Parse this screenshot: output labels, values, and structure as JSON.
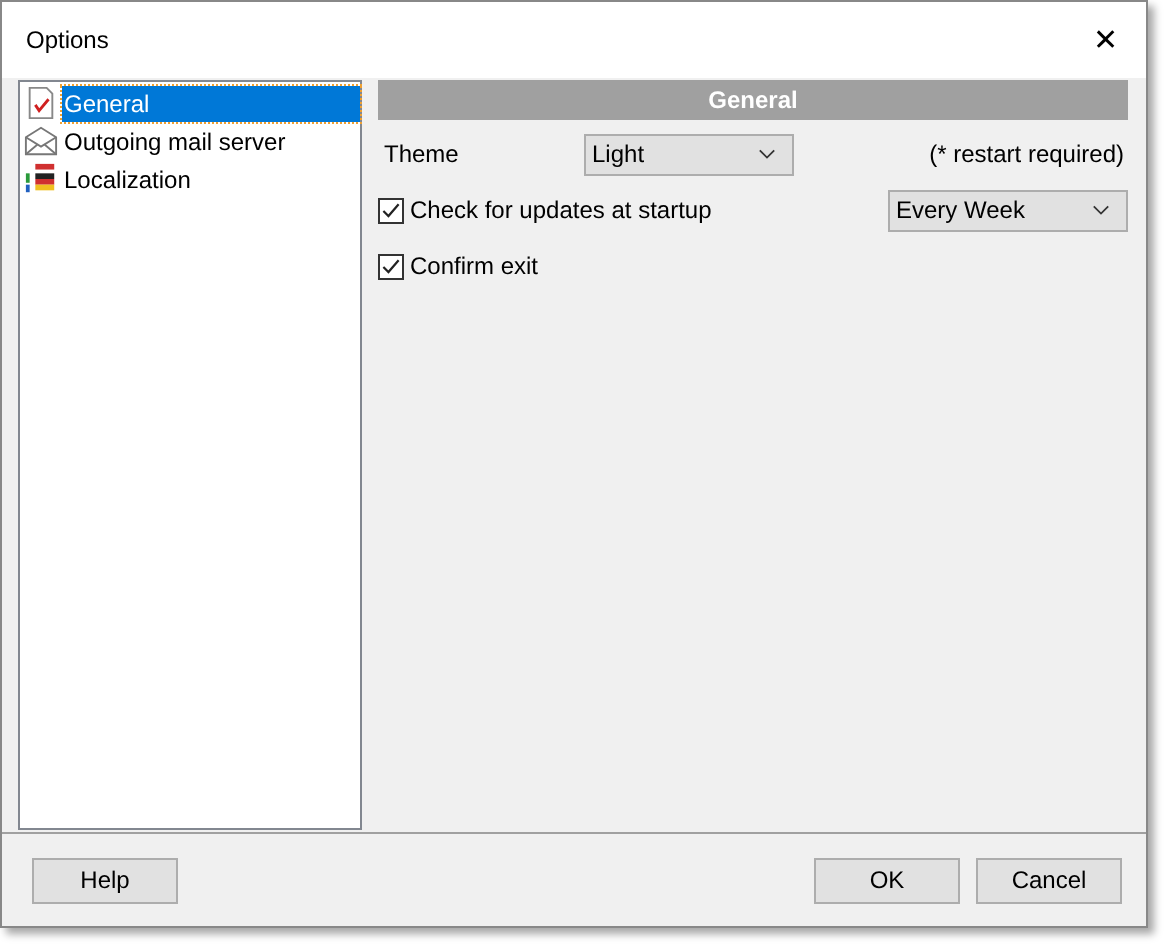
{
  "window": {
    "title": "Options",
    "close": "✕"
  },
  "sidebar": {
    "items": [
      {
        "label": "General",
        "kind": "checklist",
        "selected": true
      },
      {
        "label": "Outgoing mail server",
        "kind": "envelope",
        "selected": false
      },
      {
        "label": "Localization",
        "kind": "flags",
        "selected": false
      }
    ]
  },
  "panel": {
    "title": "General",
    "theme": {
      "label": "Theme",
      "value": "Light",
      "note": "(* restart required)"
    },
    "check_updates": {
      "label": "Check for updates at startup",
      "checked": true,
      "value": "Every Week"
    },
    "confirm_exit": {
      "label": "Confirm exit",
      "checked": true
    }
  },
  "buttons": {
    "help": "Help",
    "ok": "OK",
    "cancel": "Cancel"
  }
}
